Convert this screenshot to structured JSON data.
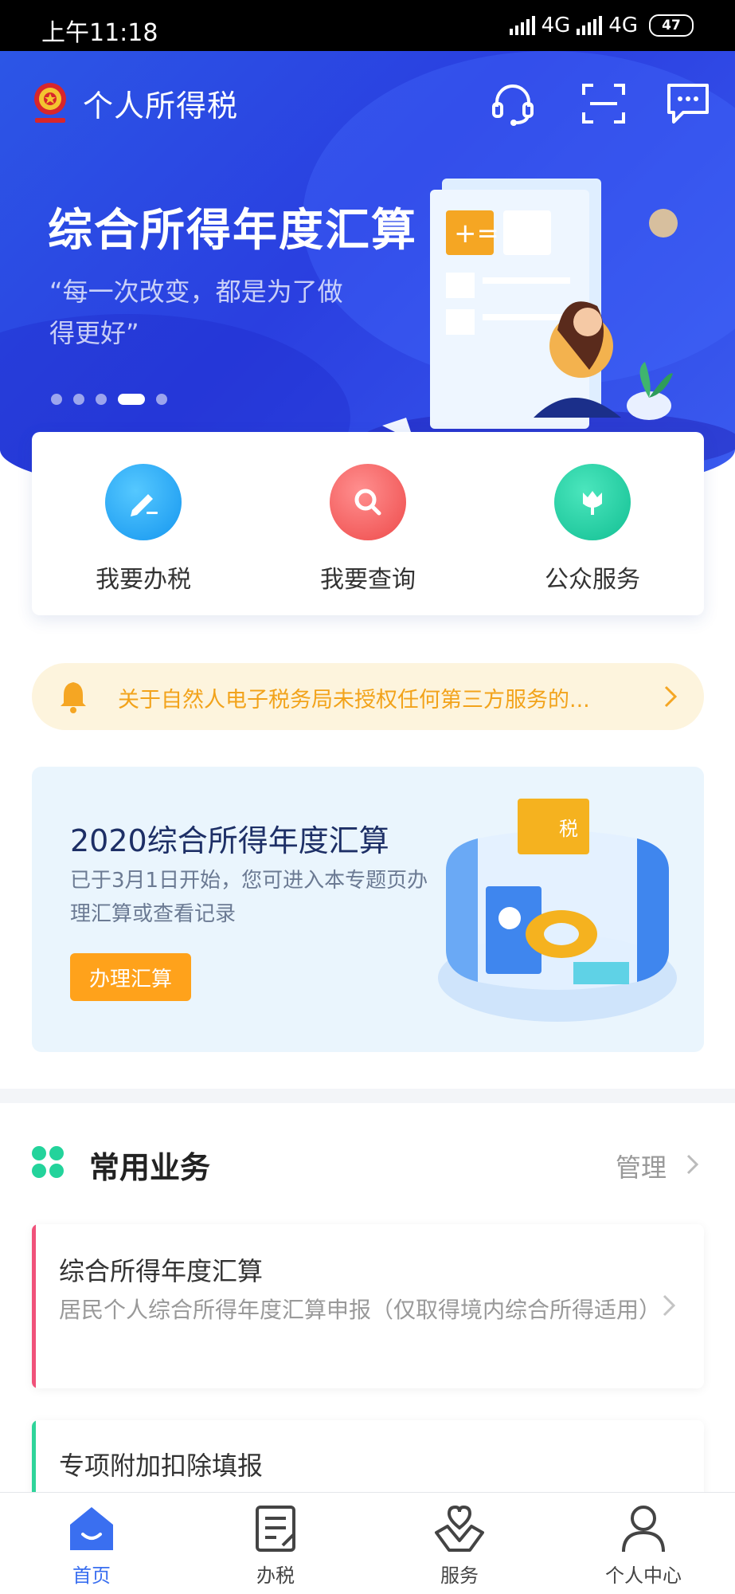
{
  "status_bar": {
    "time": "上午11:18",
    "net1": "4G",
    "net2": "4G",
    "battery": "47"
  },
  "header": {
    "title": "个人所得税",
    "icons": [
      "customer-service-icon",
      "scan-icon",
      "message-icon"
    ]
  },
  "banner": {
    "title": "综合所得年度汇算",
    "subtitle": "“每一次改变，都是为了做得更好”",
    "slide_count": 5,
    "active_slide": 4
  },
  "quick_actions": [
    {
      "label": "我要办税",
      "icon": "pencil-icon",
      "color": "#1ea8f5"
    },
    {
      "label": "我要查询",
      "icon": "magnifier-icon",
      "color": "#f35a5a"
    },
    {
      "label": "公众服务",
      "icon": "tulip-icon",
      "color": "#19c9a2"
    }
  ],
  "notice": {
    "text": "关于自然人电子税务局未授权任何第三方服务的...",
    "icon": "bell-icon"
  },
  "promo": {
    "title": "2020综合所得年度汇算",
    "description": "已于3月1日开始，您可进入本专题页办理汇算或查看记录",
    "button": "办理汇算",
    "illustration_label": "税"
  },
  "common_services": {
    "title": "常用业务",
    "manage": "管理",
    "items": [
      {
        "title": "综合所得年度汇算",
        "description": "居民个人综合所得年度汇算申报（仅取得境内综合所得适用）",
        "accent": "#f0527a"
      },
      {
        "title": "专项附加扣除填报",
        "description": "",
        "accent": "#2fd49a"
      }
    ]
  },
  "bottom_nav": {
    "active": 0,
    "items": [
      {
        "label": "首页",
        "icon": "home-icon"
      },
      {
        "label": "办税",
        "icon": "tax-form-icon"
      },
      {
        "label": "服务",
        "icon": "heart-hand-icon"
      },
      {
        "label": "个人中心",
        "icon": "user-icon"
      }
    ]
  },
  "colors": {
    "hero_blue": "#2c4be4",
    "accent_orange": "#ffa21b",
    "nav_active": "#3a6ff0"
  }
}
